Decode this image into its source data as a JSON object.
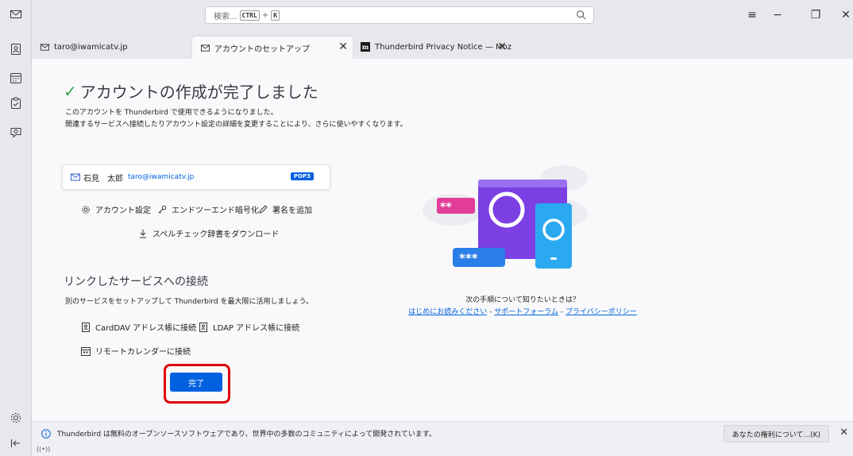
{
  "search": {
    "placeholder": "検索...",
    "shortcut_key1": "CTRL",
    "shortcut_plus": "+",
    "shortcut_key2": "K"
  },
  "window_controls": {
    "menu": "≡",
    "minimize": "−",
    "restore": "❐",
    "close": "✕"
  },
  "tabs": [
    {
      "label": "taro@iwamicatv.jp",
      "icon": "mail-icon"
    },
    {
      "label": "アカウントのセットアップ",
      "icon": "mail-icon",
      "close": "✕"
    },
    {
      "label": "Thunderbird Privacy Notice — Moz",
      "icon": "mozilla-icon",
      "close": "✕",
      "icon_text": "m"
    }
  ],
  "main": {
    "check": "✓",
    "heading": "アカウントの作成が完了しました",
    "desc1": "このアカウントを Thunderbird で使用できるようになりました。",
    "desc2": "関連するサービスへ接続したりアカウント設定の詳細を変更することにより、さらに使いやすくなります。",
    "account": {
      "name": "石見　太郎",
      "email": "taro@iwamicatv.jp",
      "badge": "POP3"
    },
    "actions": {
      "account_settings": "アカウント設定",
      "e2e": "エンドツーエンド暗号化",
      "add_signature": "署名を追加",
      "spellcheck": "スペルチェック辞書をダウンロード"
    },
    "linked_heading": "リンクしたサービスへの接続",
    "linked_desc": "別のサービスをセットアップして Thunderbird を最大限に活用しましょう。",
    "connect": {
      "carddav": "CardDAV アドレス帳に接続",
      "ldap": "LDAP アドレス帳に接続",
      "calendar": "リモートカレンダーに接続"
    },
    "done_button": "完了",
    "next_steps": "次の手順について知りたいときは？",
    "links": {
      "getting_started": "はじめにお読みください",
      "sep1": " - ",
      "support": "サポートフォーラム",
      "sep2": " - ",
      "privacy": "プライバシーポリシー"
    },
    "illustration": {
      "pw1": "**",
      "pw2": "***"
    }
  },
  "notice": {
    "text": "Thunderbird は無料のオープンソースソフトウェアであり、世界中の多数のコミュニティによって開発されています。",
    "rights_button": "あなたの権利について...(K)",
    "close": "✕"
  },
  "status": {
    "signal": "((•))"
  },
  "colors": {
    "accent": "#0061e0",
    "success": "#2fa14d",
    "highlight": "#e0000a",
    "illustration_purple": "#7b3fe4",
    "illustration_pink": "#e33d9a",
    "illustration_blue": "#2aa9f0"
  }
}
